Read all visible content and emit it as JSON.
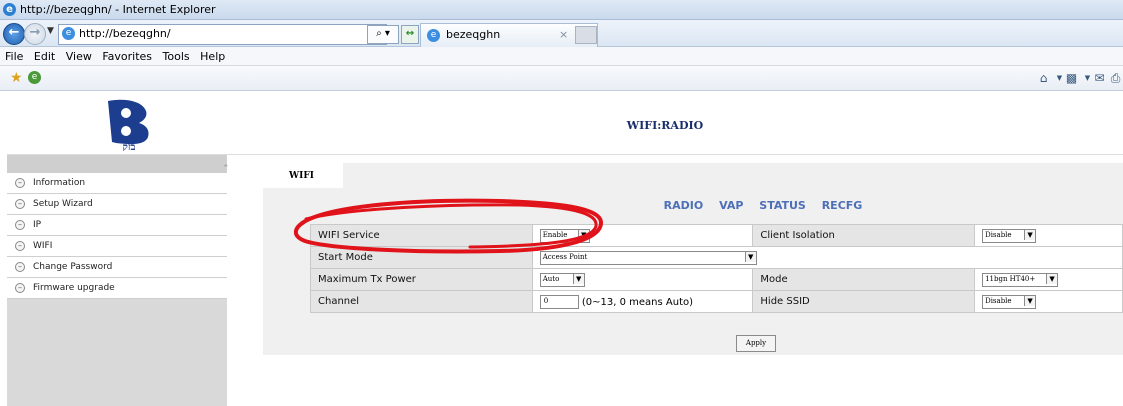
{
  "browser": {
    "window_title": "http://bezeqghn/ - Internet Explorer",
    "address": "http://bezeqghn/",
    "search_symbol": "⌕ ▾",
    "refresh_symbol": "↔",
    "tab_label": "bezeqghn",
    "tab_close": "×",
    "menu": [
      "File",
      "Edit",
      "View",
      "Favorites",
      "Tools",
      "Help"
    ],
    "command_icons": [
      "home-icon",
      "feeds-icon",
      "mail-icon",
      "print-icon"
    ]
  },
  "page": {
    "logo_text": "בזק",
    "title": "WIFI:RADIO",
    "sidebar_items": [
      {
        "label": "Information"
      },
      {
        "label": "Setup Wizard"
      },
      {
        "label": "IP"
      },
      {
        "label": "WIFI"
      },
      {
        "label": "Change Password"
      },
      {
        "label": "Firmware upgrade"
      }
    ],
    "section_tab": "WIFI",
    "subnav": [
      "RADIO",
      "VAP",
      "STATUS",
      "RECFG"
    ],
    "settings": {
      "wifi_service": {
        "label": "WIFI Service",
        "value": "Enable"
      },
      "client_isolation": {
        "label": "Client Isolation",
        "value": "Disable"
      },
      "start_mode": {
        "label": "Start Mode",
        "value": "Access Point"
      },
      "max_tx_power": {
        "label": "Maximum Tx Power",
        "value": "Auto"
      },
      "mode": {
        "label": "Mode",
        "value": "11bgn HT40+"
      },
      "channel": {
        "label": "Channel",
        "value": "0",
        "hint": "(0~13, 0 means Auto)"
      },
      "hide_ssid": {
        "label": "Hide SSID",
        "value": "Disable"
      }
    },
    "apply_label": "Apply"
  },
  "colors": {
    "title_blue": "#1a2e6e",
    "subnav_blue": "#4d6fb8",
    "annotation_red": "#e0131a"
  }
}
